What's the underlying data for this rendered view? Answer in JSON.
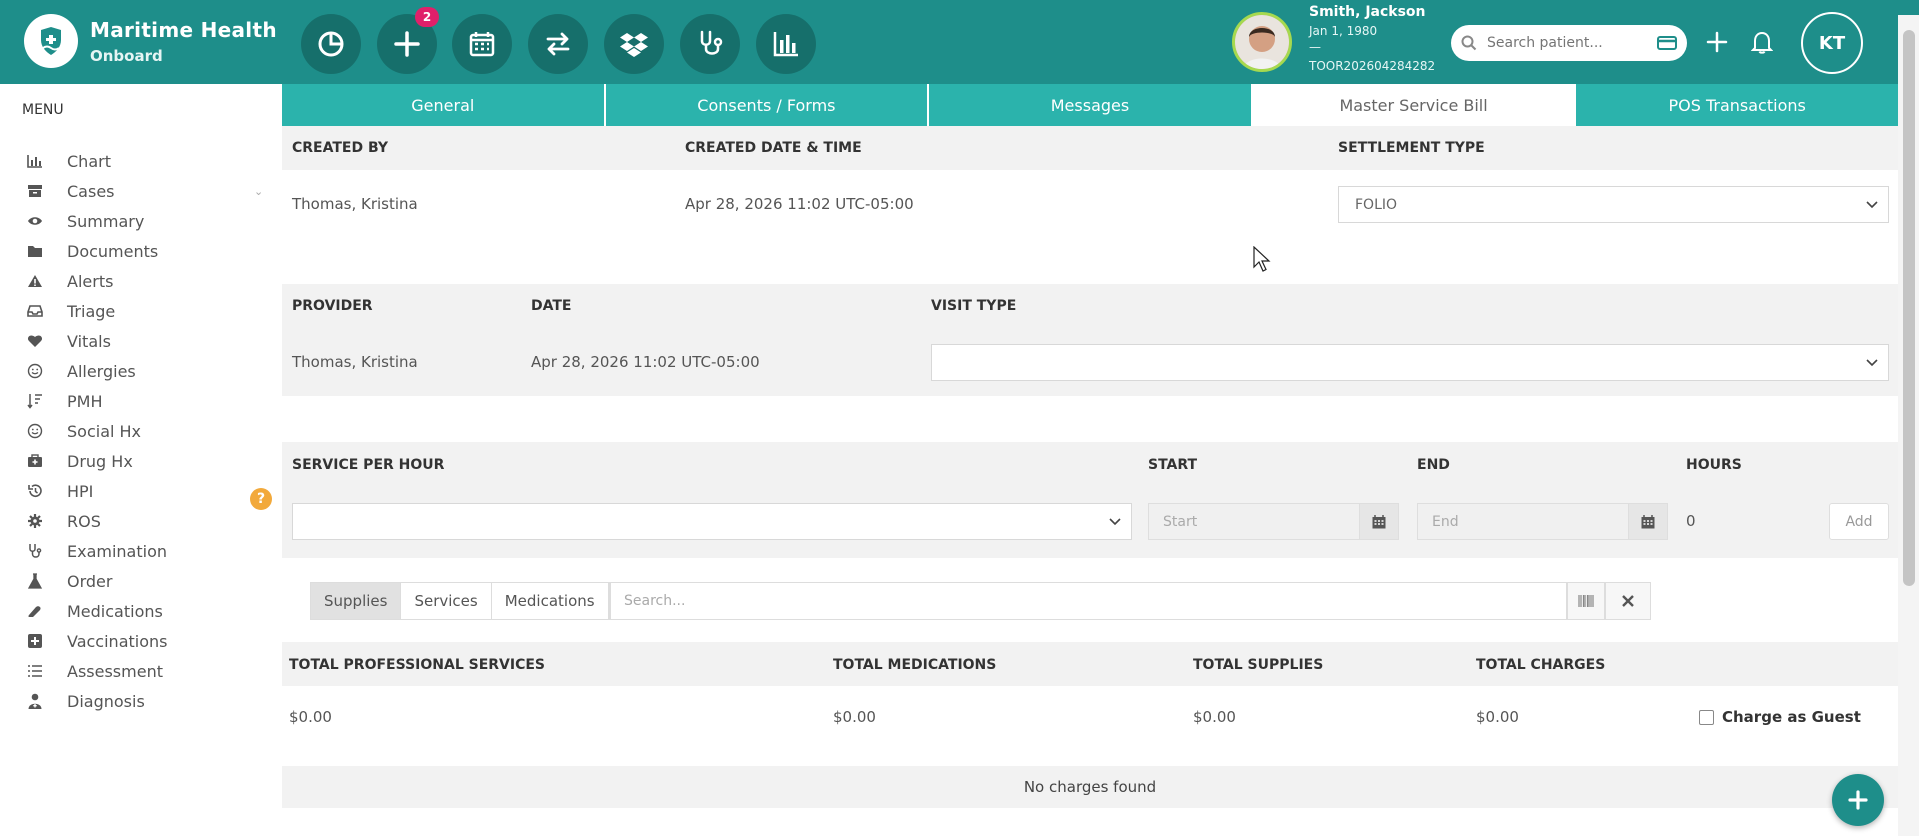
{
  "brand": {
    "name": "Maritime Health",
    "sub": "Onboard"
  },
  "toolbar": {
    "buttons": [
      {
        "icon": "pie-chart-icon"
      },
      {
        "icon": "plus-icon",
        "badge": "2"
      },
      {
        "icon": "calendar-icon"
      },
      {
        "icon": "transfer-icon"
      },
      {
        "icon": "dropbox-icon"
      },
      {
        "icon": "stethoscope-icon"
      },
      {
        "icon": "bar-chart-icon"
      }
    ]
  },
  "patient": {
    "name": "Smith, Jackson",
    "dob": "Jan 1, 1980",
    "dash": "—",
    "id": "TOOR202604284282"
  },
  "search": {
    "placeholder": "Search patient..."
  },
  "user": {
    "initials": "KT"
  },
  "menu": {
    "title": "MENU",
    "items": [
      {
        "label": "Chart",
        "icon": "bar-chart-icon"
      },
      {
        "label": "Cases",
        "icon": "archive-icon"
      },
      {
        "label": "Summary",
        "icon": "eye-icon"
      },
      {
        "label": "Documents",
        "icon": "folder-icon"
      },
      {
        "label": "Alerts",
        "icon": "warning-icon"
      },
      {
        "label": "Triage",
        "icon": "inbox-icon"
      },
      {
        "label": "Vitals",
        "icon": "heart-icon"
      },
      {
        "label": "Allergies",
        "icon": "smile-icon"
      },
      {
        "label": "PMH",
        "icon": "sort-icon"
      },
      {
        "label": "Social Hx",
        "icon": "smile-icon"
      },
      {
        "label": "Drug Hx",
        "icon": "medkit-icon"
      },
      {
        "label": "HPI",
        "icon": "history-icon"
      },
      {
        "label": "ROS",
        "icon": "gear-icon"
      },
      {
        "label": "Examination",
        "icon": "stethoscope-icon"
      },
      {
        "label": "Order",
        "icon": "flask-icon"
      },
      {
        "label": "Medications",
        "icon": "pill-icon"
      },
      {
        "label": "Vaccinations",
        "icon": "plus-square-icon"
      },
      {
        "label": "Assessment",
        "icon": "list-icon"
      },
      {
        "label": "Diagnosis",
        "icon": "doctor-icon"
      }
    ],
    "help": "?"
  },
  "tabs": [
    {
      "label": "General",
      "active": false
    },
    {
      "label": "Consents / Forms",
      "active": false
    },
    {
      "label": "Messages",
      "active": false
    },
    {
      "label": "Master Service Bill",
      "active": true
    },
    {
      "label": "POS Transactions",
      "active": false
    }
  ],
  "bill": {
    "created_by_label": "CREATED BY",
    "created_dt_label": "CREATED DATE & TIME",
    "settlement_label": "SETTLEMENT TYPE",
    "created_by": "Thomas, Kristina",
    "created_dt": "Apr 28, 2026 11:02 UTC-05:00",
    "settlement": "FOLIO",
    "provider_label": "PROVIDER",
    "date_label": "DATE",
    "visit_type_label": "VISIT TYPE",
    "provider": "Thomas, Kristina",
    "date": "Apr 28, 2026 11:02 UTC-05:00",
    "visit_type": "",
    "service_label": "SERVICE PER HOUR",
    "start_label": "START",
    "end_label": "END",
    "hours_label": "HOURS",
    "start_placeholder": "Start",
    "end_placeholder": "End",
    "hours": "0",
    "add": "Add"
  },
  "items": {
    "segments": [
      {
        "label": "Supplies",
        "active": true
      },
      {
        "label": "Services",
        "active": false
      },
      {
        "label": "Medications",
        "active": false
      }
    ],
    "search_placeholder": "Search..."
  },
  "totals": {
    "professional_label": "TOTAL PROFESSIONAL SERVICES",
    "medications_label": "TOTAL MEDICATIONS",
    "supplies_label": "TOTAL SUPPLIES",
    "charges_label": "TOTAL CHARGES",
    "professional": "$0.00",
    "medications": "$0.00",
    "supplies": "$0.00",
    "charges": "$0.00",
    "guest_label": "Charge as Guest"
  },
  "empty_state": "No charges found",
  "colors": {
    "header": "#1e8e8a",
    "tab": "#2bb3ac",
    "badge": "#e0206a",
    "help": "#f2a93b"
  }
}
